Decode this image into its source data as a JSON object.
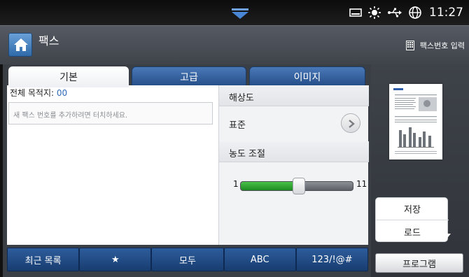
{
  "status_bar": {
    "time": "11:27",
    "icons": [
      "pull-down-arrow-icon",
      "toner-icon",
      "brightness-icon",
      "usb-icon",
      "network-globe-icon"
    ]
  },
  "header": {
    "title": "팩스",
    "home_icon": "home-icon",
    "fax_number_input": "팩스번호 입력"
  },
  "tabs": [
    {
      "label": "기본",
      "active": true
    },
    {
      "label": "고급",
      "active": false
    },
    {
      "label": "이미지",
      "active": false
    }
  ],
  "left_pane": {
    "dest_label": "전체 목적지: ",
    "dest_count": "00",
    "fax_placeholder": "새 팩스 번호를 추가하려면 터치하세요."
  },
  "right_pane": {
    "resolution_header": "해상도",
    "resolution_value": "표준",
    "density_header": "농도 조절",
    "density_min": "1",
    "density_max": "11",
    "density_level": 5,
    "density_level_fraction": 0.52
  },
  "keybar": [
    "최근 목록",
    "★",
    "모두",
    "ABC",
    "123/!@#"
  ],
  "popup": {
    "save": "저장",
    "load": "로드"
  },
  "program_button": "프로그램",
  "colors": {
    "tab_active": "#ffffff",
    "tab_inactive": "#2f5f9e",
    "slider_fill": "#2ea232",
    "link_blue": "#2f6ab8"
  }
}
